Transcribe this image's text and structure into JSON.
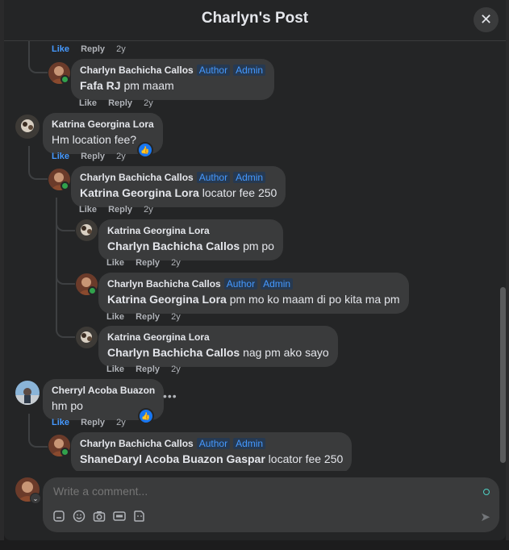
{
  "header": {
    "title": "Charlyn's Post"
  },
  "tags": {
    "author": "Author",
    "admin": "Admin"
  },
  "actions": {
    "like": "Like",
    "reply": "Reply",
    "time": "2y"
  },
  "comments": [
    {
      "name": "Charlyn Bachicha Callos",
      "text_plain": "pm maam",
      "mention": "Fafa RJ"
    },
    {
      "name": "Katrina Georgina Lora",
      "text_plain": "Hm location fee?"
    },
    {
      "name": "Charlyn Bachicha Callos",
      "mention": "Katrina Georgina Lora",
      "text_plain": "locator fee 250"
    },
    {
      "name": "Katrina Georgina Lora",
      "mention": "Charlyn Bachicha Callos",
      "text_plain": "pm po"
    },
    {
      "name": "Charlyn Bachicha Callos",
      "mention": "Katrina Georgina Lora",
      "text_plain": "pm mo ko maam di po kita ma pm"
    },
    {
      "name": "Katrina Georgina Lora",
      "mention": "Charlyn Bachicha Callos",
      "text_plain": "nag pm ako sayo"
    },
    {
      "name": "Cherryl Acoba Buazon",
      "text_plain": "hm po"
    },
    {
      "name": "Charlyn Bachicha Callos",
      "mention": "ShaneDaryl Acoba Buazon Gaspar",
      "text_plain": "locator fee 250"
    }
  ],
  "composer": {
    "placeholder": "Write a comment..."
  },
  "colors": {
    "accent": "#4599ff",
    "bubble": "#3a3b3c",
    "background": "#242526"
  },
  "icons": [
    "close-icon",
    "like-badge-icon",
    "more-dots-icon",
    "sticker-icon",
    "emoji-icon",
    "camera-icon",
    "gif-icon",
    "avatar-icon",
    "send-icon"
  ]
}
